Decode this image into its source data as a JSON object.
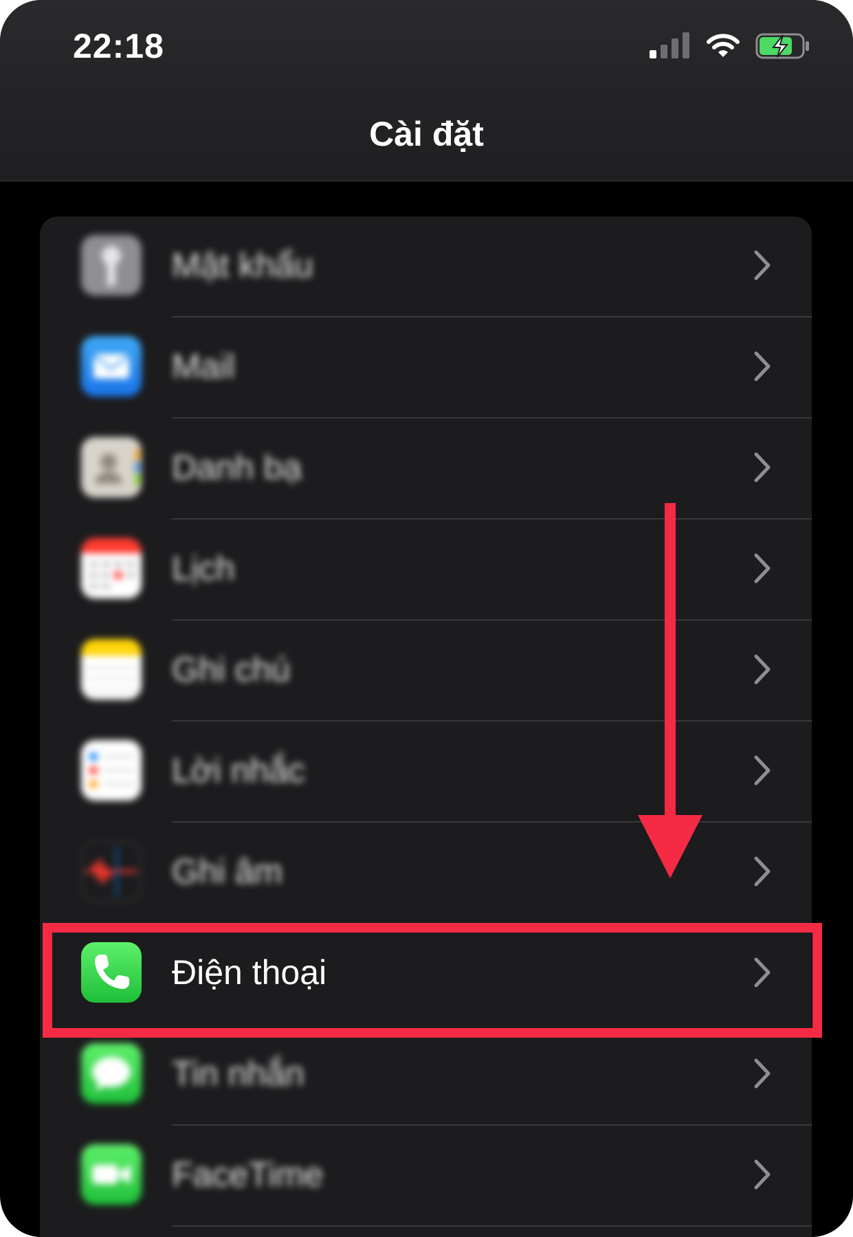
{
  "status_bar": {
    "time": "22:18",
    "signal_icon": "cellular-signal-icon",
    "wifi_icon": "wifi-icon",
    "battery_icon": "battery-charging-icon",
    "battery_color": "#4cd964"
  },
  "nav": {
    "title": "Cài đặt"
  },
  "settings": {
    "rows": [
      {
        "label": "Mật khẩu",
        "icon": "key-icon",
        "blurred": true
      },
      {
        "label": "Mail",
        "icon": "mail-icon",
        "blurred": true
      },
      {
        "label": "Danh bạ",
        "icon": "contacts-icon",
        "blurred": true
      },
      {
        "label": "Lịch",
        "icon": "calendar-icon",
        "blurred": true
      },
      {
        "label": "Ghi chú",
        "icon": "notes-icon",
        "blurred": true
      },
      {
        "label": "Lời nhắc",
        "icon": "reminders-icon",
        "blurred": true
      },
      {
        "label": "Ghi âm",
        "icon": "voice-memos-icon",
        "blurred": true
      },
      {
        "label": "Điện thoại",
        "icon": "phone-icon",
        "blurred": false
      },
      {
        "label": "Tin nhắn",
        "icon": "messages-icon",
        "blurred": true
      },
      {
        "label": "FaceTime",
        "icon": "facetime-icon",
        "blurred": true
      }
    ]
  },
  "annotation": {
    "highlight_color": "#f52a45",
    "arrow_icon": "down-arrow-icon",
    "highlighted_item": "Điện thoại"
  }
}
